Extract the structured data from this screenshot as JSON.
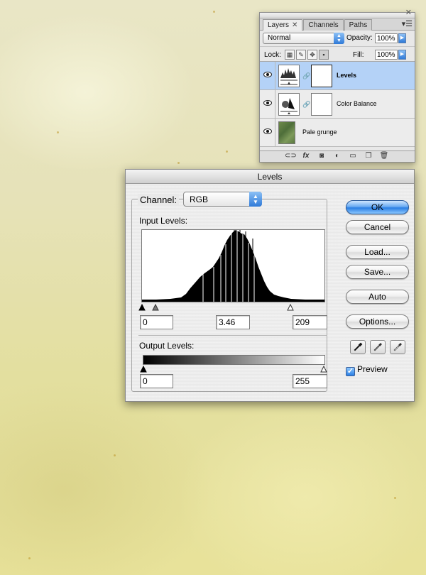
{
  "layers_panel": {
    "tabs": [
      {
        "label": "Layers",
        "closable": true
      },
      {
        "label": "Channels"
      },
      {
        "label": "Paths"
      }
    ],
    "blend_mode": "Normal",
    "opacity_label": "Opacity:",
    "opacity_value": "100%",
    "lock_label": "Lock:",
    "fill_label": "Fill:",
    "fill_value": "100%",
    "layers": [
      {
        "name": "Levels",
        "selected": true,
        "type": "adjustment-levels"
      },
      {
        "name": "Color Balance",
        "selected": false,
        "type": "adjustment-color-balance"
      },
      {
        "name": "Pale grunge",
        "selected": false,
        "type": "image"
      }
    ],
    "bottom_icons": [
      "link-icon",
      "fx-icon",
      "mask-icon",
      "adjustment-icon",
      "folder-icon",
      "new-layer-icon",
      "trash-icon"
    ],
    "fx_label": "fx"
  },
  "levels_dialog": {
    "title": "Levels",
    "channel_label": "Channel:",
    "channel_value": "RGB",
    "input_levels_label": "Input Levels:",
    "input_black": "0",
    "input_gamma": "3.46",
    "input_white": "209",
    "output_levels_label": "Output Levels:",
    "output_black": "0",
    "output_white": "255",
    "buttons": {
      "ok": "OK",
      "cancel": "Cancel",
      "load": "Load...",
      "save": "Save...",
      "auto": "Auto",
      "options": "Options..."
    },
    "preview_label": "Preview",
    "preview_checked": true,
    "accent_color": "#2a7ee3"
  }
}
